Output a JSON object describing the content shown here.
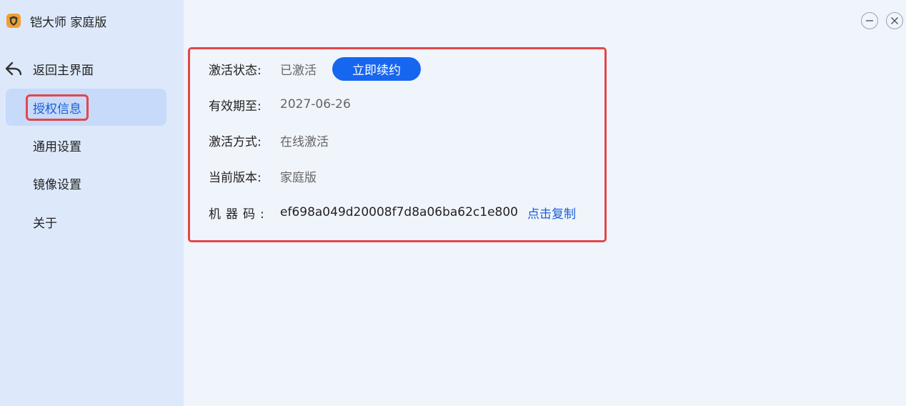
{
  "app": {
    "title": "铠大师 家庭版",
    "logo_icon": "shield-logo-icon",
    "brand_color": "#f0a030"
  },
  "sidebar": {
    "back_label": "返回主界面",
    "back_icon": "back-arrow-icon",
    "items": [
      {
        "label": "授权信息",
        "active": true
      },
      {
        "label": "通用设置",
        "active": false
      },
      {
        "label": "镜像设置",
        "active": false
      },
      {
        "label": "关于",
        "active": false
      }
    ]
  },
  "window_controls": {
    "minimize_icon": "minimize-icon",
    "close_icon": "close-icon"
  },
  "license": {
    "status_label": "激活状态:",
    "status_value": "已激活",
    "renew_button": "立即续约",
    "expiry_label": "有效期至:",
    "expiry_value": "2027-06-26",
    "method_label": "激活方式:",
    "method_value": "在线激活",
    "version_label": "当前版本:",
    "version_value": "家庭版",
    "machine_label": "机器码:",
    "machine_value": "ef698a049d20008f7d8a06ba62c1e800",
    "copy_link": "点击复制"
  },
  "colors": {
    "accent": "#1766f0",
    "highlight_border": "#e2474a",
    "sidebar_bg": "#dde9fb",
    "active_item_bg": "#c7dafa"
  }
}
